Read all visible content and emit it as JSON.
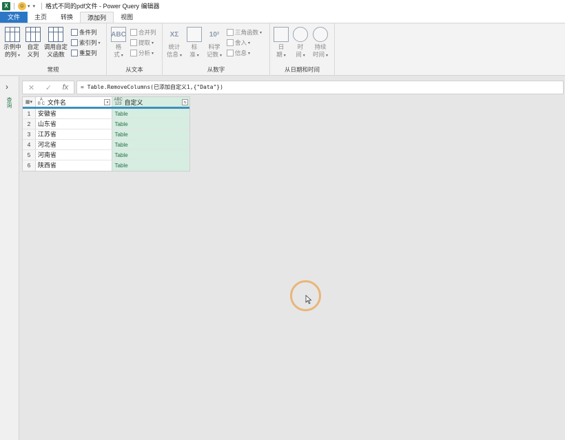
{
  "titlebar": {
    "app_icon": "X",
    "title": "格式不同的pdf文件 - Power Query 编辑器"
  },
  "tabs": [
    {
      "label": "文件"
    },
    {
      "label": "主页"
    },
    {
      "label": "转换"
    },
    {
      "label": "添加列"
    },
    {
      "label": "视图"
    }
  ],
  "ribbon": {
    "general": {
      "label": "常规",
      "example_col": [
        "示例中",
        "的列"
      ],
      "custom_col": [
        "自定",
        "义列"
      ],
      "invoke_fn": [
        "调用自定",
        "义函数"
      ],
      "conditional_col": "条件列",
      "index_col": "索引列",
      "duplicate_col": "重复列"
    },
    "from_text": {
      "label": "从文本",
      "format": [
        "格",
        "式"
      ],
      "merge_cols": "合并列",
      "extract": "提取",
      "parse": "分析",
      "abc_icon": "ABC"
    },
    "from_number": {
      "label": "从数字",
      "statistics": [
        "统计",
        "信息"
      ],
      "standard": [
        "标",
        "准"
      ],
      "scientific": [
        "科学",
        "记数"
      ],
      "trig": "三角函数",
      "rounding": "舍入",
      "info": "信息",
      "sigma_icon": "XΣ",
      "ten_icon": "10²"
    },
    "from_date": {
      "label": "从日期和时间",
      "date": [
        "日",
        "期"
      ],
      "time": [
        "时",
        "间"
      ],
      "duration": [
        "持续",
        "时间"
      ]
    }
  },
  "leftnav": {
    "arrow": "›",
    "label": "查询"
  },
  "formula": {
    "cancel": "✕",
    "confirm": "✓",
    "fx": "fx",
    "text": "= Table.RemoveColumns(已添加自定义1,{\"Data\"})"
  },
  "grid": {
    "columns": [
      {
        "type_top": "A",
        "type_bottom": "B C",
        "name": "文件名"
      },
      {
        "type_top": "ABC",
        "type_bottom": "123",
        "name": "自定义"
      }
    ],
    "rows": [
      {
        "num": "1",
        "name": "安徽省",
        "value": "Table"
      },
      {
        "num": "2",
        "name": "山东省",
        "value": "Table"
      },
      {
        "num": "3",
        "name": "江苏省",
        "value": "Table"
      },
      {
        "num": "4",
        "name": "河北省",
        "value": "Table"
      },
      {
        "num": "5",
        "name": "河南省",
        "value": "Table"
      },
      {
        "num": "6",
        "name": "陕西省",
        "value": "Table"
      }
    ]
  },
  "colors": {
    "file_tab": "#2b77c5",
    "header_accent": "#3c8fbd",
    "custom_col_bg": "#d6ede1",
    "cursor_ring": "#e9b67a"
  }
}
